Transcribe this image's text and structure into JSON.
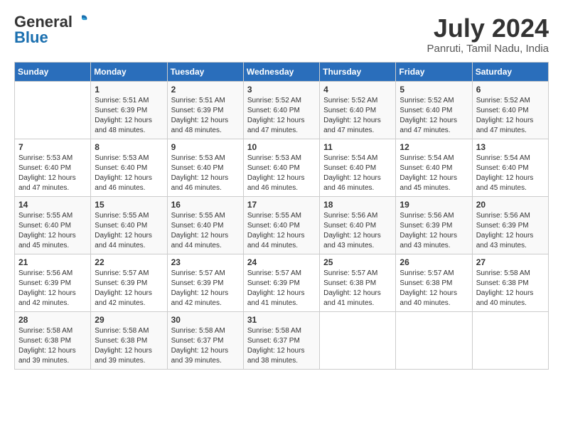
{
  "logo": {
    "general": "General",
    "blue": "Blue"
  },
  "title": "July 2024",
  "subtitle": "Panruti, Tamil Nadu, India",
  "days_header": [
    "Sunday",
    "Monday",
    "Tuesday",
    "Wednesday",
    "Thursday",
    "Friday",
    "Saturday"
  ],
  "weeks": [
    [
      {
        "day": "",
        "text": ""
      },
      {
        "day": "1",
        "text": "Sunrise: 5:51 AM\nSunset: 6:39 PM\nDaylight: 12 hours\nand 48 minutes."
      },
      {
        "day": "2",
        "text": "Sunrise: 5:51 AM\nSunset: 6:39 PM\nDaylight: 12 hours\nand 48 minutes."
      },
      {
        "day": "3",
        "text": "Sunrise: 5:52 AM\nSunset: 6:40 PM\nDaylight: 12 hours\nand 47 minutes."
      },
      {
        "day": "4",
        "text": "Sunrise: 5:52 AM\nSunset: 6:40 PM\nDaylight: 12 hours\nand 47 minutes."
      },
      {
        "day": "5",
        "text": "Sunrise: 5:52 AM\nSunset: 6:40 PM\nDaylight: 12 hours\nand 47 minutes."
      },
      {
        "day": "6",
        "text": "Sunrise: 5:52 AM\nSunset: 6:40 PM\nDaylight: 12 hours\nand 47 minutes."
      }
    ],
    [
      {
        "day": "7",
        "text": "Sunrise: 5:53 AM\nSunset: 6:40 PM\nDaylight: 12 hours\nand 47 minutes."
      },
      {
        "day": "8",
        "text": "Sunrise: 5:53 AM\nSunset: 6:40 PM\nDaylight: 12 hours\nand 46 minutes."
      },
      {
        "day": "9",
        "text": "Sunrise: 5:53 AM\nSunset: 6:40 PM\nDaylight: 12 hours\nand 46 minutes."
      },
      {
        "day": "10",
        "text": "Sunrise: 5:53 AM\nSunset: 6:40 PM\nDaylight: 12 hours\nand 46 minutes."
      },
      {
        "day": "11",
        "text": "Sunrise: 5:54 AM\nSunset: 6:40 PM\nDaylight: 12 hours\nand 46 minutes."
      },
      {
        "day": "12",
        "text": "Sunrise: 5:54 AM\nSunset: 6:40 PM\nDaylight: 12 hours\nand 45 minutes."
      },
      {
        "day": "13",
        "text": "Sunrise: 5:54 AM\nSunset: 6:40 PM\nDaylight: 12 hours\nand 45 minutes."
      }
    ],
    [
      {
        "day": "14",
        "text": "Sunrise: 5:55 AM\nSunset: 6:40 PM\nDaylight: 12 hours\nand 45 minutes."
      },
      {
        "day": "15",
        "text": "Sunrise: 5:55 AM\nSunset: 6:40 PM\nDaylight: 12 hours\nand 44 minutes."
      },
      {
        "day": "16",
        "text": "Sunrise: 5:55 AM\nSunset: 6:40 PM\nDaylight: 12 hours\nand 44 minutes."
      },
      {
        "day": "17",
        "text": "Sunrise: 5:55 AM\nSunset: 6:40 PM\nDaylight: 12 hours\nand 44 minutes."
      },
      {
        "day": "18",
        "text": "Sunrise: 5:56 AM\nSunset: 6:40 PM\nDaylight: 12 hours\nand 43 minutes."
      },
      {
        "day": "19",
        "text": "Sunrise: 5:56 AM\nSunset: 6:39 PM\nDaylight: 12 hours\nand 43 minutes."
      },
      {
        "day": "20",
        "text": "Sunrise: 5:56 AM\nSunset: 6:39 PM\nDaylight: 12 hours\nand 43 minutes."
      }
    ],
    [
      {
        "day": "21",
        "text": "Sunrise: 5:56 AM\nSunset: 6:39 PM\nDaylight: 12 hours\nand 42 minutes."
      },
      {
        "day": "22",
        "text": "Sunrise: 5:57 AM\nSunset: 6:39 PM\nDaylight: 12 hours\nand 42 minutes."
      },
      {
        "day": "23",
        "text": "Sunrise: 5:57 AM\nSunset: 6:39 PM\nDaylight: 12 hours\nand 42 minutes."
      },
      {
        "day": "24",
        "text": "Sunrise: 5:57 AM\nSunset: 6:39 PM\nDaylight: 12 hours\nand 41 minutes."
      },
      {
        "day": "25",
        "text": "Sunrise: 5:57 AM\nSunset: 6:38 PM\nDaylight: 12 hours\nand 41 minutes."
      },
      {
        "day": "26",
        "text": "Sunrise: 5:57 AM\nSunset: 6:38 PM\nDaylight: 12 hours\nand 40 minutes."
      },
      {
        "day": "27",
        "text": "Sunrise: 5:58 AM\nSunset: 6:38 PM\nDaylight: 12 hours\nand 40 minutes."
      }
    ],
    [
      {
        "day": "28",
        "text": "Sunrise: 5:58 AM\nSunset: 6:38 PM\nDaylight: 12 hours\nand 39 minutes."
      },
      {
        "day": "29",
        "text": "Sunrise: 5:58 AM\nSunset: 6:38 PM\nDaylight: 12 hours\nand 39 minutes."
      },
      {
        "day": "30",
        "text": "Sunrise: 5:58 AM\nSunset: 6:37 PM\nDaylight: 12 hours\nand 39 minutes."
      },
      {
        "day": "31",
        "text": "Sunrise: 5:58 AM\nSunset: 6:37 PM\nDaylight: 12 hours\nand 38 minutes."
      },
      {
        "day": "",
        "text": ""
      },
      {
        "day": "",
        "text": ""
      },
      {
        "day": "",
        "text": ""
      }
    ]
  ]
}
